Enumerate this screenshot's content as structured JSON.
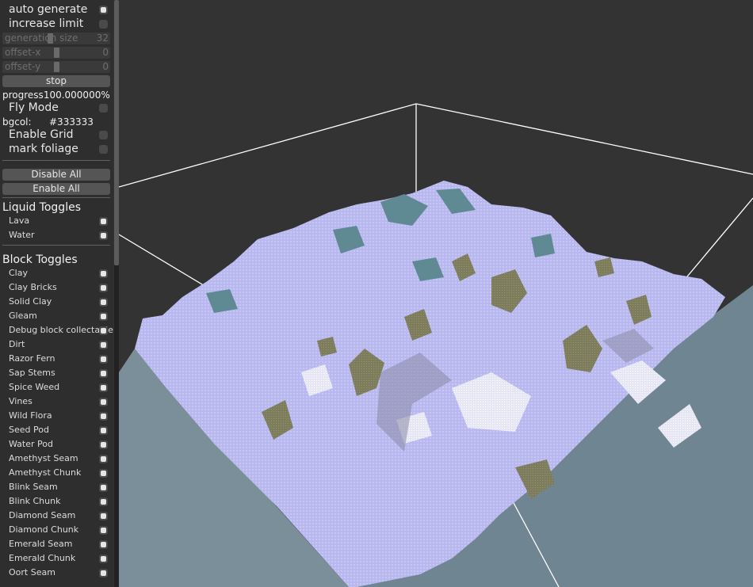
{
  "panel": {
    "checkboxes": {
      "auto_generate": {
        "label": "auto generate",
        "checked": true
      },
      "increase_limit": {
        "label": "increase limit",
        "checked": false
      }
    },
    "sliders": {
      "generation_size": {
        "label": "generation size",
        "value": "32"
      },
      "offset_x": {
        "label": "offset-x",
        "value": "0"
      },
      "offset_y": {
        "label": "offset-y",
        "value": "0"
      }
    },
    "stop_button": "stop",
    "progress": {
      "label": "progress",
      "value": "100.000000%"
    },
    "fly_mode": {
      "label": "Fly Mode",
      "checked": false
    },
    "bgcol": {
      "label": "bgcol:",
      "value": "#333333"
    },
    "enable_grid": {
      "label": "Enable Grid",
      "checked": false
    },
    "mark_foliage": {
      "label": "mark foliage",
      "checked": false
    },
    "disable_all_button": "Disable All",
    "enable_all_button": "Enable All",
    "liquid_toggles": {
      "title": "Liquid Toggles",
      "items": [
        {
          "label": "Lava",
          "checked": true
        },
        {
          "label": "Water",
          "checked": true
        }
      ]
    },
    "block_toggles": {
      "title": "Block Toggles",
      "items": [
        {
          "label": "Clay",
          "checked": true
        },
        {
          "label": "Clay Bricks",
          "checked": true
        },
        {
          "label": "Solid Clay",
          "checked": true
        },
        {
          "label": "Gleam",
          "checked": true
        },
        {
          "label": "Debug block collectable",
          "checked": true
        },
        {
          "label": "Dirt",
          "checked": true
        },
        {
          "label": "Razor Fern",
          "checked": true
        },
        {
          "label": "Sap Stems",
          "checked": true
        },
        {
          "label": "Spice Weed",
          "checked": true
        },
        {
          "label": "Vines",
          "checked": true
        },
        {
          "label": "Wild Flora",
          "checked": true
        },
        {
          "label": "Seed Pod",
          "checked": true
        },
        {
          "label": "Water Pod",
          "checked": true
        },
        {
          "label": "Amethyst Seam",
          "checked": true
        },
        {
          "label": "Amethyst Chunk",
          "checked": true
        },
        {
          "label": "Blink Seam",
          "checked": true
        },
        {
          "label": "Blink Chunk",
          "checked": true
        },
        {
          "label": "Diamond Seam",
          "checked": true
        },
        {
          "label": "Diamond Chunk",
          "checked": true
        },
        {
          "label": "Emerald Seam",
          "checked": true
        },
        {
          "label": "Emerald Chunk",
          "checked": true
        },
        {
          "label": "Oort Seam",
          "checked": true
        }
      ]
    }
  },
  "colors": {
    "background": "#333333",
    "terrain_top": "#b9b9f0",
    "terrain_side": "#7b8f9a",
    "moss": "#7a7a5a",
    "teal": "#5f8a93",
    "bounding_box": "#ffffff"
  }
}
